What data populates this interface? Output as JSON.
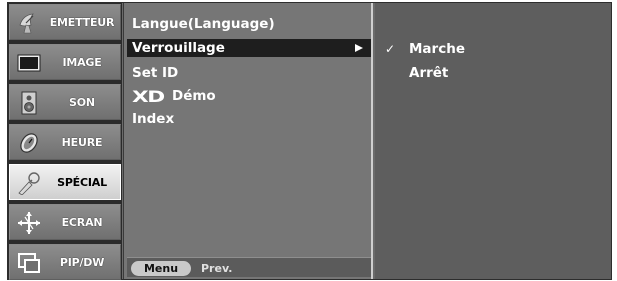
{
  "categories": [
    {
      "label": "EMETTEUR",
      "icon": "satellite-dish-icon",
      "active": false
    },
    {
      "label": "IMAGE",
      "icon": "screen-icon",
      "active": false
    },
    {
      "label": "SON",
      "icon": "speaker-icon",
      "active": false
    },
    {
      "label": "HEURE",
      "icon": "clock-icon",
      "active": false
    },
    {
      "label": "SPÉCIAL",
      "icon": "key-icon",
      "active": true
    },
    {
      "label": "ECRAN",
      "icon": "move-arrows-icon",
      "active": false
    },
    {
      "label": "PIP/DW",
      "icon": "pip-windows-icon",
      "active": false
    }
  ],
  "submenu": {
    "items": [
      {
        "label": "Langue(Language)"
      },
      {
        "label": "Verrouillage",
        "highlighted": true,
        "has_submenu": true
      },
      {
        "label": "Set ID"
      },
      {
        "label": "Démo",
        "logo": "XD"
      },
      {
        "label": "Index"
      }
    ],
    "footer": {
      "menu_label": "Menu",
      "prev_label": "Prev."
    }
  },
  "options": {
    "items": [
      {
        "label": "Marche",
        "checked": true,
        "check_mark": "✓"
      },
      {
        "label": "Arrêt",
        "checked": false
      }
    ]
  },
  "colors": {
    "panel_bg": "#767676",
    "highlight_bg": "#1e1e1e",
    "active_tab_bg": "#e8e8e8",
    "text": "#ffffff"
  }
}
